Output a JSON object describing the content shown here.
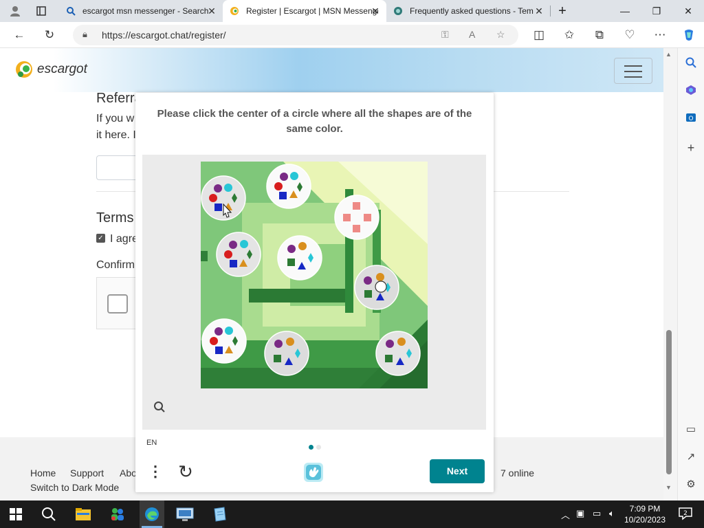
{
  "browser": {
    "tabs": [
      {
        "title": "escargot msn messenger - Search",
        "active": false
      },
      {
        "title": "Register | Escargot | MSN Messenger",
        "active": true
      },
      {
        "title": "Frequently asked questions - Tem",
        "active": false
      }
    ],
    "url": "https://escargot.chat/register/"
  },
  "site": {
    "brand": "escargot",
    "referral_heading": "Referra",
    "referral_line1": "If you w",
    "referral_line2": "it here. I",
    "terms_heading": "Terms",
    "agree_text": "I agre",
    "confirm_heading": "Confirm",
    "footer_links": [
      "Home",
      "Support",
      "Abo"
    ],
    "dark_mode": "Switch to Dark Mode",
    "online_text": "7 online"
  },
  "captcha": {
    "prompt": "Please click the center of a circle where all the shapes are of the same color.",
    "language": "EN",
    "next_label": "Next",
    "pages": [
      true,
      false
    ]
  },
  "taskbar": {
    "time": "7:09 PM",
    "date": "10/20/2023",
    "notification_count": "2"
  },
  "colors": {
    "accent": "#00838f",
    "brand_gradient": "#9fd0ef"
  }
}
